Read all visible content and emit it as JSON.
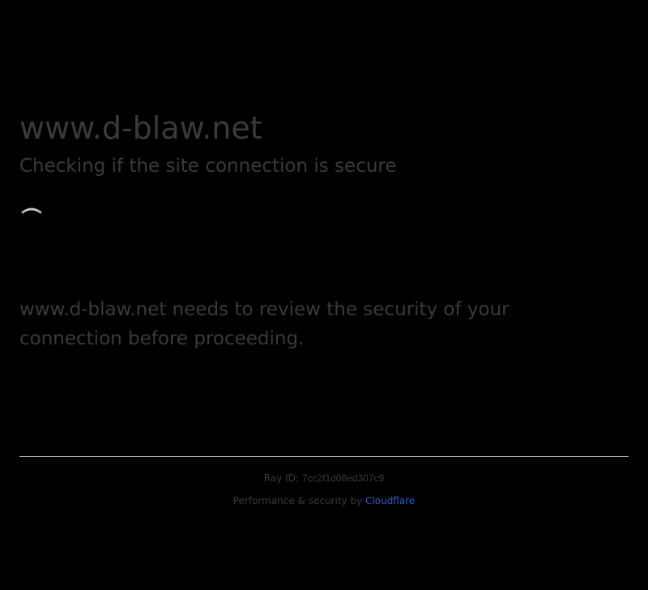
{
  "page": {
    "site_title": "www.d-blaw.net",
    "subtitle": "Checking if the site connection is secure",
    "body_text": "www.d-blaw.net needs to review the security of your connection before proceeding."
  },
  "spinner": {
    "icon": "loading-spinner-icon"
  },
  "footer": {
    "ray_label": "Ray ID:",
    "ray_id": "7cc2f1d08ed307c9",
    "perf_text": "Performance & security by",
    "provider_link": "Cloudflare"
  },
  "colors": {
    "background": "#000000",
    "text": "#3a3a3a",
    "link": "#2c5bd8",
    "divider": "#d9d9d9"
  }
}
